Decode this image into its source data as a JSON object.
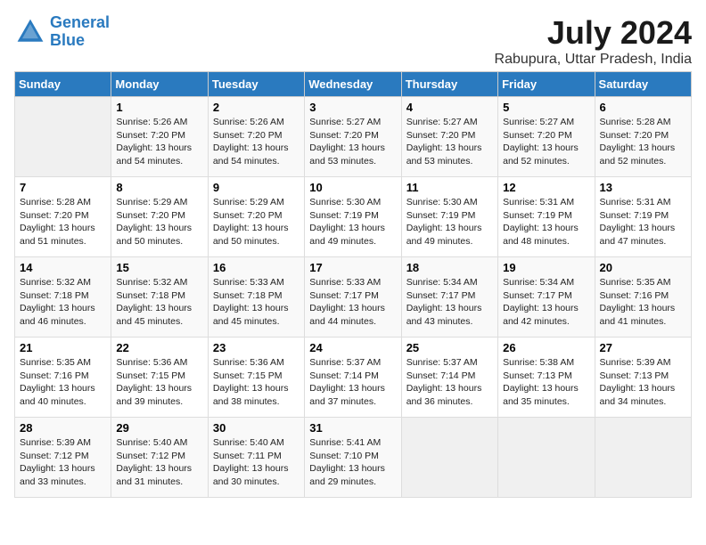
{
  "header": {
    "logo_line1": "General",
    "logo_line2": "Blue",
    "month_year": "July 2024",
    "location": "Rabupura, Uttar Pradesh, India"
  },
  "days_of_week": [
    "Sunday",
    "Monday",
    "Tuesday",
    "Wednesday",
    "Thursday",
    "Friday",
    "Saturday"
  ],
  "weeks": [
    [
      {
        "day": "",
        "info": ""
      },
      {
        "day": "1",
        "info": "Sunrise: 5:26 AM\nSunset: 7:20 PM\nDaylight: 13 hours\nand 54 minutes."
      },
      {
        "day": "2",
        "info": "Sunrise: 5:26 AM\nSunset: 7:20 PM\nDaylight: 13 hours\nand 54 minutes."
      },
      {
        "day": "3",
        "info": "Sunrise: 5:27 AM\nSunset: 7:20 PM\nDaylight: 13 hours\nand 53 minutes."
      },
      {
        "day": "4",
        "info": "Sunrise: 5:27 AM\nSunset: 7:20 PM\nDaylight: 13 hours\nand 53 minutes."
      },
      {
        "day": "5",
        "info": "Sunrise: 5:27 AM\nSunset: 7:20 PM\nDaylight: 13 hours\nand 52 minutes."
      },
      {
        "day": "6",
        "info": "Sunrise: 5:28 AM\nSunset: 7:20 PM\nDaylight: 13 hours\nand 52 minutes."
      }
    ],
    [
      {
        "day": "7",
        "info": "Sunrise: 5:28 AM\nSunset: 7:20 PM\nDaylight: 13 hours\nand 51 minutes."
      },
      {
        "day": "8",
        "info": "Sunrise: 5:29 AM\nSunset: 7:20 PM\nDaylight: 13 hours\nand 50 minutes."
      },
      {
        "day": "9",
        "info": "Sunrise: 5:29 AM\nSunset: 7:20 PM\nDaylight: 13 hours\nand 50 minutes."
      },
      {
        "day": "10",
        "info": "Sunrise: 5:30 AM\nSunset: 7:19 PM\nDaylight: 13 hours\nand 49 minutes."
      },
      {
        "day": "11",
        "info": "Sunrise: 5:30 AM\nSunset: 7:19 PM\nDaylight: 13 hours\nand 49 minutes."
      },
      {
        "day": "12",
        "info": "Sunrise: 5:31 AM\nSunset: 7:19 PM\nDaylight: 13 hours\nand 48 minutes."
      },
      {
        "day": "13",
        "info": "Sunrise: 5:31 AM\nSunset: 7:19 PM\nDaylight: 13 hours\nand 47 minutes."
      }
    ],
    [
      {
        "day": "14",
        "info": "Sunrise: 5:32 AM\nSunset: 7:18 PM\nDaylight: 13 hours\nand 46 minutes."
      },
      {
        "day": "15",
        "info": "Sunrise: 5:32 AM\nSunset: 7:18 PM\nDaylight: 13 hours\nand 45 minutes."
      },
      {
        "day": "16",
        "info": "Sunrise: 5:33 AM\nSunset: 7:18 PM\nDaylight: 13 hours\nand 45 minutes."
      },
      {
        "day": "17",
        "info": "Sunrise: 5:33 AM\nSunset: 7:17 PM\nDaylight: 13 hours\nand 44 minutes."
      },
      {
        "day": "18",
        "info": "Sunrise: 5:34 AM\nSunset: 7:17 PM\nDaylight: 13 hours\nand 43 minutes."
      },
      {
        "day": "19",
        "info": "Sunrise: 5:34 AM\nSunset: 7:17 PM\nDaylight: 13 hours\nand 42 minutes."
      },
      {
        "day": "20",
        "info": "Sunrise: 5:35 AM\nSunset: 7:16 PM\nDaylight: 13 hours\nand 41 minutes."
      }
    ],
    [
      {
        "day": "21",
        "info": "Sunrise: 5:35 AM\nSunset: 7:16 PM\nDaylight: 13 hours\nand 40 minutes."
      },
      {
        "day": "22",
        "info": "Sunrise: 5:36 AM\nSunset: 7:15 PM\nDaylight: 13 hours\nand 39 minutes."
      },
      {
        "day": "23",
        "info": "Sunrise: 5:36 AM\nSunset: 7:15 PM\nDaylight: 13 hours\nand 38 minutes."
      },
      {
        "day": "24",
        "info": "Sunrise: 5:37 AM\nSunset: 7:14 PM\nDaylight: 13 hours\nand 37 minutes."
      },
      {
        "day": "25",
        "info": "Sunrise: 5:37 AM\nSunset: 7:14 PM\nDaylight: 13 hours\nand 36 minutes."
      },
      {
        "day": "26",
        "info": "Sunrise: 5:38 AM\nSunset: 7:13 PM\nDaylight: 13 hours\nand 35 minutes."
      },
      {
        "day": "27",
        "info": "Sunrise: 5:39 AM\nSunset: 7:13 PM\nDaylight: 13 hours\nand 34 minutes."
      }
    ],
    [
      {
        "day": "28",
        "info": "Sunrise: 5:39 AM\nSunset: 7:12 PM\nDaylight: 13 hours\nand 33 minutes."
      },
      {
        "day": "29",
        "info": "Sunrise: 5:40 AM\nSunset: 7:12 PM\nDaylight: 13 hours\nand 31 minutes."
      },
      {
        "day": "30",
        "info": "Sunrise: 5:40 AM\nSunset: 7:11 PM\nDaylight: 13 hours\nand 30 minutes."
      },
      {
        "day": "31",
        "info": "Sunrise: 5:41 AM\nSunset: 7:10 PM\nDaylight: 13 hours\nand 29 minutes."
      },
      {
        "day": "",
        "info": ""
      },
      {
        "day": "",
        "info": ""
      },
      {
        "day": "",
        "info": ""
      }
    ]
  ]
}
